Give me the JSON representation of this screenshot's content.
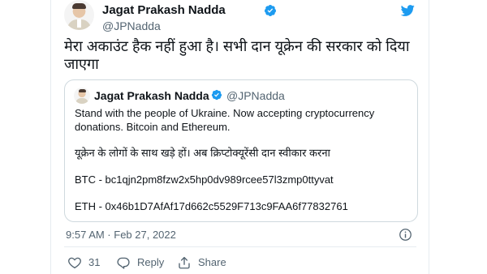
{
  "colors": {
    "twitter_blue": "#1d9bf0",
    "text_primary": "#0f1419",
    "text_secondary": "#536471",
    "border": "#cfd9de"
  },
  "author": {
    "name": "Jagat Prakash Nadda",
    "handle": "@JPNadda",
    "verified_icon": "verified-badge-icon",
    "logo_icon": "twitter-bird-icon"
  },
  "tweet": {
    "text": "मेरा अकाउंट हैक नहीं हुआ है। सभी दान यूक्रेन की सरकार को दिया जाएगा"
  },
  "quoted_tweet": {
    "author_name": "Jagat Prakash Nadda",
    "author_handle": "@JPNadda",
    "lines": [
      "Stand with the people of Ukraine. Now accepting cryptocurrency",
      "donations. Bitcoin and Ethereum.",
      "यूक्रेन के लोगों के साथ खड़े हों। अब क्रिप्टोक्यूरेंसी दान स्वीकार करना",
      "BTC - bc1qjn2pm8fzw2x5hp0dv989rcee57l3zmp0ttyvat",
      "ETH - 0x46b1D7AfAf17d662c5529F713c9FAA6f77832761"
    ]
  },
  "meta": {
    "timestamp": "9:57 AM · Feb 27, 2022",
    "info_icon": "info-icon"
  },
  "actions": {
    "like_icon": "heart-icon",
    "like_count": "31",
    "reply_icon": "reply-icon",
    "reply_label": "Reply",
    "share_icon": "share-icon",
    "share_label": "Share"
  }
}
